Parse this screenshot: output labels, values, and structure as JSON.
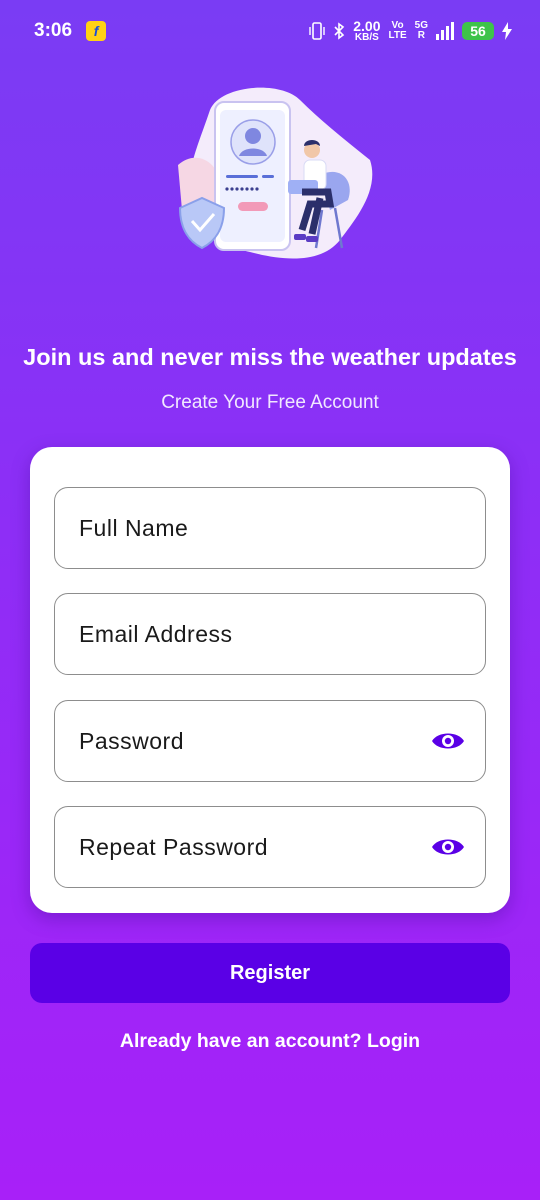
{
  "status_bar": {
    "time": "3:06",
    "app_icon": "flipkart-icon",
    "net_speed_value": "2.00",
    "net_speed_unit": "KB/S",
    "volte_top": "Vo",
    "volte_bottom": "LTE",
    "network_top": "5G",
    "network_bottom": "R",
    "battery_level": "56",
    "battery_color": "#3ec34a"
  },
  "header": {
    "title": "Join us and never miss the weather updates",
    "subtitle": "Create Your Free Account"
  },
  "form": {
    "full_name": {
      "label": "Full Name"
    },
    "email": {
      "label": "Email Address"
    },
    "password": {
      "label": "Password",
      "toggle_icon": "eye-icon"
    },
    "repeat_password": {
      "label": "Repeat Password",
      "toggle_icon": "eye-icon"
    }
  },
  "actions": {
    "register_label": "Register",
    "login_prompt": "Already have an account? Login"
  },
  "colors": {
    "accent": "#5a00e6",
    "background_top": "#7a3cf4",
    "background_bottom": "#a820f8"
  }
}
